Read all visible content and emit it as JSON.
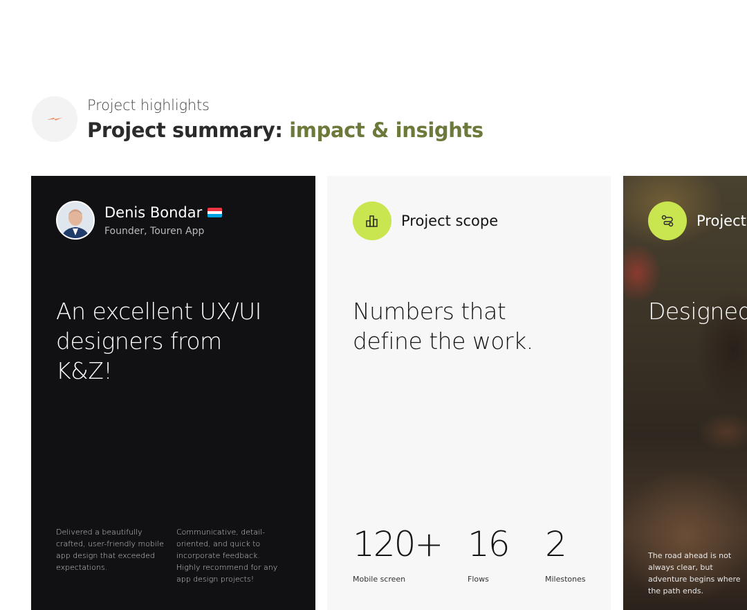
{
  "header": {
    "icon": "bolt-icon",
    "eyebrow": "Project highlights",
    "title_main": "Project summary: ",
    "title_accent": "impact & insights",
    "accent_color": "#6b7a3a",
    "icon_color": "#f08a5d"
  },
  "testimonial": {
    "name": "Denis Bondar",
    "flag": "luxembourg-flag-icon",
    "role": "Founder, Touren App",
    "quote": "An excellent UX/UI designers from K&Z!",
    "column_1": "Delivered a beautifully crafted, user-friendly mobile app design that exceeded expectations.",
    "column_2": "Communicative, detail-oriented, and quick to incorporate feedback. Highly recommend for any app design projects!",
    "background": "#111113"
  },
  "scope": {
    "icon": "bar-chart-icon",
    "title": "Project scope",
    "headline": "Numbers that define the work.",
    "accent_color": "#c9e650",
    "stats": [
      {
        "value": "120+",
        "label": "Mobile screen"
      },
      {
        "value": "16",
        "label": "Flows"
      },
      {
        "value": "2",
        "label": "Milestones"
      }
    ]
  },
  "photo_card": {
    "icon": "route-icon",
    "title": "Project",
    "headline": "Designed bold. Built adventure",
    "caption": "The road ahead is not always clear, but adventure begins where the path ends."
  }
}
